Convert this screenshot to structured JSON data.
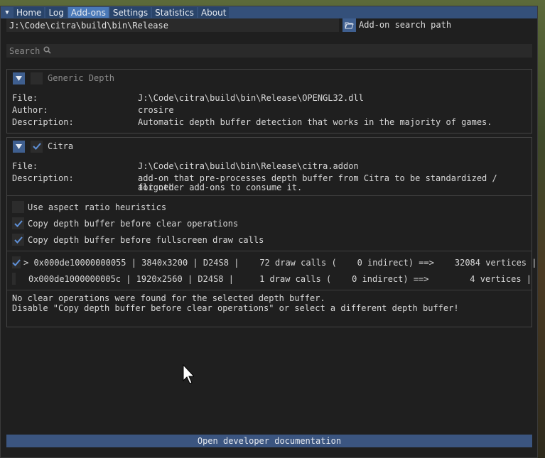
{
  "tabs": [
    {
      "label": "Home",
      "active": false
    },
    {
      "label": "Log",
      "active": false
    },
    {
      "label": "Add-ons",
      "active": true
    },
    {
      "label": "Settings",
      "active": false
    },
    {
      "label": "Statistics",
      "active": false
    },
    {
      "label": "About",
      "active": false
    }
  ],
  "path": {
    "value": "J:\\Code\\citra\\build\\bin\\Release",
    "label": "Add-on search path",
    "folder_icon": "folder-open-icon"
  },
  "search": {
    "placeholder": "Search",
    "icon": "search-icon"
  },
  "addons": [
    {
      "name": "Generic Depth",
      "enabled": false,
      "expanded": true,
      "fields": [
        {
          "key": "File:",
          "value": "J:\\Code\\citra\\build\\bin\\Release\\OPENGL32.dll"
        },
        {
          "key": "Author:",
          "value": "crosire"
        },
        {
          "key": "Description:",
          "value": "Automatic depth buffer detection that works in the majority of games."
        }
      ]
    },
    {
      "name": "Citra",
      "enabled": true,
      "expanded": true,
      "fields": [
        {
          "key": "File:",
          "value": "J:\\Code\\citra\\build\\bin\\Release\\citra.addon"
        },
        {
          "key": "Description:",
          "value": "add-on that pre-processes depth buffer from Citra to be standardized / aligned",
          "value2": "for other add-ons to consume it."
        }
      ],
      "options": [
        {
          "label": "Use aspect ratio heuristics",
          "checked": false
        },
        {
          "label": "Copy depth buffer before clear operations",
          "checked": true
        },
        {
          "label": "Copy depth buffer before fullscreen draw calls",
          "checked": true
        }
      ],
      "buffers": [
        {
          "checked": true,
          "text": "> 0x000de10000000055 | 3840x3200 | D24S8 |    72 draw calls (    0 indirect) ==>    32084 vertices |"
        },
        {
          "checked": false,
          "text": "  0x000de1000000005c | 1920x2560 | D24S8 |     1 draw calls (    0 indirect) ==>        4 vertices |"
        }
      ],
      "message": [
        "No clear operations were found for the selected depth buffer.",
        "Disable \"Copy depth buffer before clear operations\" or select a different depth buffer!"
      ]
    }
  ],
  "bottom_button": "Open developer documentation"
}
